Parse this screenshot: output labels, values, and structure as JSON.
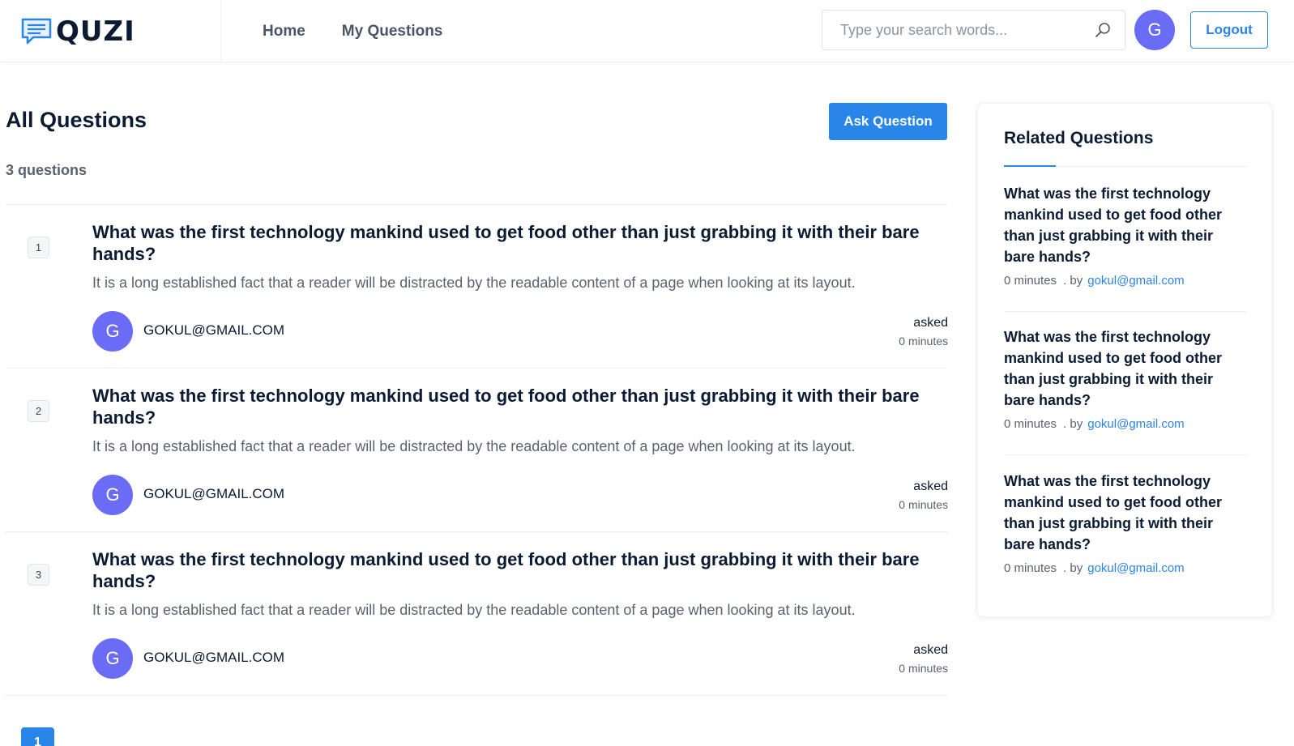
{
  "brand": {
    "name": "QUZI",
    "accent_color": "#2a85e8"
  },
  "nav": {
    "home": "Home",
    "my_questions": "My Questions"
  },
  "search": {
    "placeholder": "Type your search words..."
  },
  "user": {
    "avatar_letter": "G"
  },
  "header": {
    "logout_label": "Logout"
  },
  "main": {
    "title": "All Questions",
    "ask_label": "Ask Question",
    "count_label": "3 questions",
    "questions": [
      {
        "number": "1",
        "title": "What was the first technology mankind used to get food other than just grabbing it with their bare hands?",
        "body": "It is a long established fact that a reader will be distracted by the readable content of a page when looking at its layout.",
        "avatar": "G",
        "user": "GOKUL@GMAIL.COM",
        "asked_label": "asked",
        "time": "0 minutes"
      },
      {
        "number": "2",
        "title": "What was the first technology mankind used to get food other than just grabbing it with their bare hands?",
        "body": "It is a long established fact that a reader will be distracted by the readable content of a page when looking at its layout.",
        "avatar": "G",
        "user": "GOKUL@GMAIL.COM",
        "asked_label": "asked",
        "time": "0 minutes"
      },
      {
        "number": "3",
        "title": "What was the first technology mankind used to get food other than just grabbing it with their bare hands?",
        "body": "It is a long established fact that a reader will be distracted by the readable content of a page when looking at its layout.",
        "avatar": "G",
        "user": "GOKUL@GMAIL.COM",
        "asked_label": "asked",
        "time": "0 minutes"
      }
    ],
    "pagination": {
      "current": "1"
    }
  },
  "sidebar": {
    "title": "Related Questions",
    "items": [
      {
        "title": "What was the first technology mankind used to get food other than just grabbing it with their bare hands?",
        "time": "0 minutes",
        "by": ". by",
        "email": "gokul@gmail.com"
      },
      {
        "title": "What was the first technology mankind used to get food other than just grabbing it with their bare hands?",
        "time": "0 minutes",
        "by": ". by",
        "email": "gokul@gmail.com"
      },
      {
        "title": "What was the first technology mankind used to get food other than just grabbing it with their bare hands?",
        "time": "0 minutes",
        "by": ". by",
        "email": "gokul@gmail.com"
      }
    ]
  }
}
